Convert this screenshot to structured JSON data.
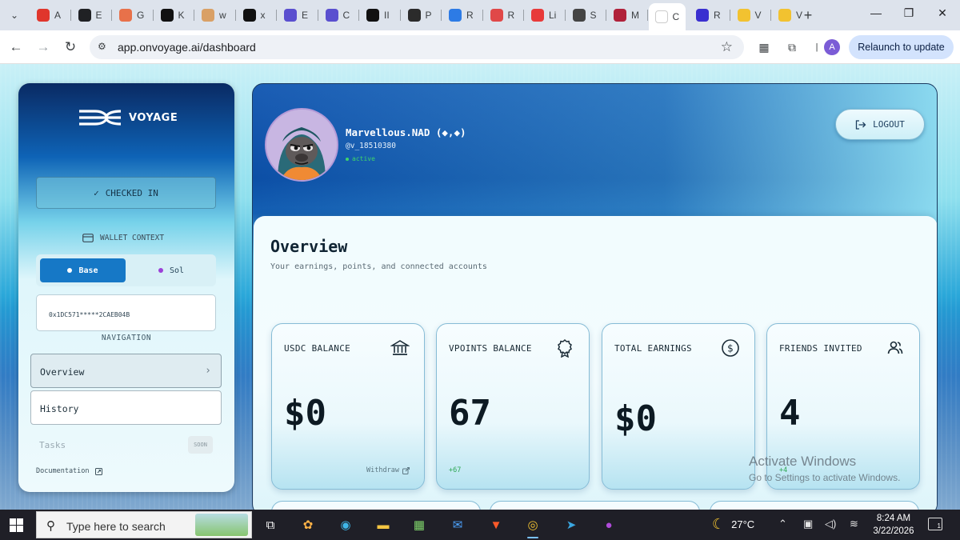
{
  "browser": {
    "tabs": [
      {
        "label": "A",
        "color": "#e0362c"
      },
      {
        "label": "E",
        "color": "#202124"
      },
      {
        "label": "G",
        "color": "#e8714a"
      },
      {
        "label": "K",
        "color": "#111111"
      },
      {
        "label": "w",
        "color": "#d9a066"
      },
      {
        "label": "x",
        "color": "#111111"
      },
      {
        "label": "E",
        "color": "#5a4fcf"
      },
      {
        "label": "C",
        "color": "#5a4fcf"
      },
      {
        "label": "II",
        "color": "#111111"
      },
      {
        "label": "P",
        "color": "#2b2b2b"
      },
      {
        "label": "R",
        "color": "#2d7be5"
      },
      {
        "label": "R",
        "color": "#e04848"
      },
      {
        "label": "Li",
        "color": "#e83a3a"
      },
      {
        "label": "S",
        "color": "#444444"
      },
      {
        "label": "M",
        "color": "#b0213a"
      },
      {
        "label": "C",
        "color": "#ffffff",
        "active": true
      },
      {
        "label": "R",
        "color": "#3a2fd0"
      },
      {
        "label": "V",
        "color": "#f2c230"
      },
      {
        "label": "V",
        "color": "#f2c230"
      }
    ],
    "url": "app.onvoyage.ai/dashboard",
    "relaunch_label": "Relaunch to update",
    "profile_initial": "A"
  },
  "sidebar": {
    "brand": "VOYAGE",
    "checkin_label": "CHECKED IN",
    "wallet_context_label": "WALLET CONTEXT",
    "chains": {
      "base": "Base",
      "sol": "Sol"
    },
    "address": "0x1DC571*****2CAEB04B",
    "navigation_label": "NAVIGATION",
    "nav": {
      "overview": "Overview",
      "history": "History"
    },
    "tasks_label": "Tasks",
    "soon_badge": "SOON",
    "docs_label": "Documentation",
    "colors": {
      "active_chain": "#1678c6",
      "sol_dot": "#9b40d8"
    }
  },
  "profile": {
    "username": "Marvellous.NAD (◆,◆)",
    "handle": "@v_18510380",
    "status": "active",
    "logout_label": "LOGOUT"
  },
  "overview": {
    "title": "Overview",
    "subtitle": "Your earnings, points, and connected accounts",
    "cards": [
      {
        "label": "USDC BALANCE",
        "value": "$0",
        "icon": "bank-icon",
        "foot": "Withdraw"
      },
      {
        "label": "VPOINTS BALANCE",
        "value": "67",
        "icon": "award-icon",
        "foot": "+67"
      },
      {
        "label": "TOTAL EARNINGS",
        "value": "$0",
        "icon": "dollar-circle-icon",
        "foot": ""
      },
      {
        "label": "FRIENDS INVITED",
        "value": "4",
        "icon": "users-icon",
        "foot": "+4"
      }
    ]
  },
  "watermark": {
    "line1": "Activate Windows",
    "line2": "Go to Settings to activate Windows."
  },
  "taskbar": {
    "search_placeholder": "Type here to search",
    "weather_temp": "27°C",
    "time": "8:24 AM",
    "date": "3/22/2026",
    "notify_count": "1"
  }
}
